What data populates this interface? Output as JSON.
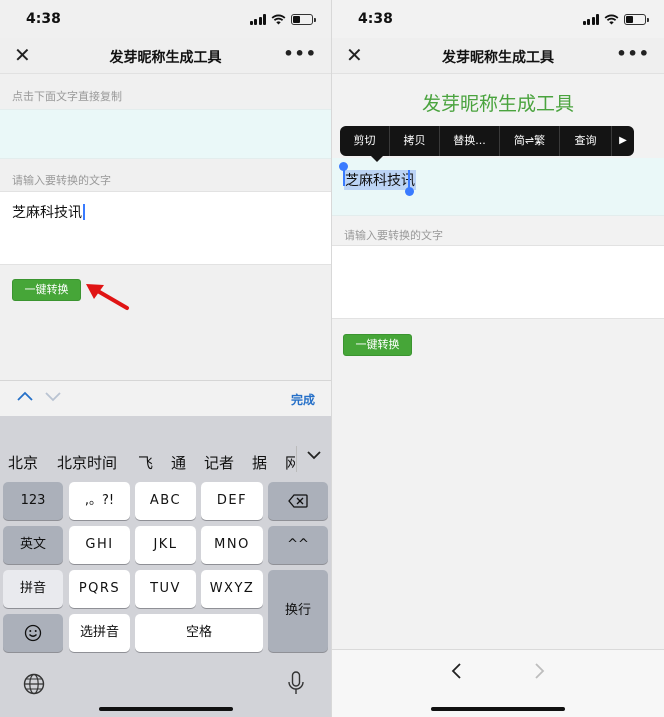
{
  "status": {
    "time": "4:38"
  },
  "left": {
    "navbar": {
      "title": "发芽昵称生成工具",
      "close_glyph": "✕",
      "more_glyph": "•••"
    },
    "output_hint": "点击下面文字直接复制",
    "output_text": "",
    "input_hint": "请输入要转换的文字",
    "input_value": "芝麻科技讯",
    "convert_label": "一键转换",
    "accessory": {
      "done_label": "完成"
    },
    "candidates": [
      "北京",
      "北京时间",
      "飞",
      "通",
      "记者",
      "据",
      "网"
    ],
    "keys": {
      "row1": [
        "123",
        ",。?!",
        "ABC",
        "DEF"
      ],
      "row2": [
        "英文",
        "GHI",
        "JKL",
        "MNO",
        "^^"
      ],
      "row3": [
        "拼音",
        "PQRS",
        "TUV",
        "WXYZ"
      ],
      "enter": "换行",
      "row4": [
        "选拼音",
        "空格"
      ]
    }
  },
  "right": {
    "navbar": {
      "title": "发芽昵称生成工具",
      "close_glyph": "✕",
      "more_glyph": "•••"
    },
    "brand": "发芽昵称生成工具",
    "context_menu": [
      "剪切",
      "拷贝",
      "替换...",
      "简⇌繁",
      "查询",
      "▶"
    ],
    "output_text": "芝麻科技讯",
    "input_hint": "请输入要转换的文字",
    "input_value": "",
    "convert_label": "一键转换"
  },
  "colors": {
    "accent_green": "#46a638",
    "link_blue": "#2670c8",
    "selection_blue": "#3a7bff"
  },
  "icons": [
    "close-icon",
    "more-icon",
    "chevron-up-icon",
    "chevron-down-icon",
    "backspace-icon",
    "emoji-icon",
    "globe-icon",
    "microphone-icon",
    "chevron-left-icon",
    "chevron-right-icon",
    "wifi-icon",
    "signal-icon",
    "battery-icon"
  ]
}
